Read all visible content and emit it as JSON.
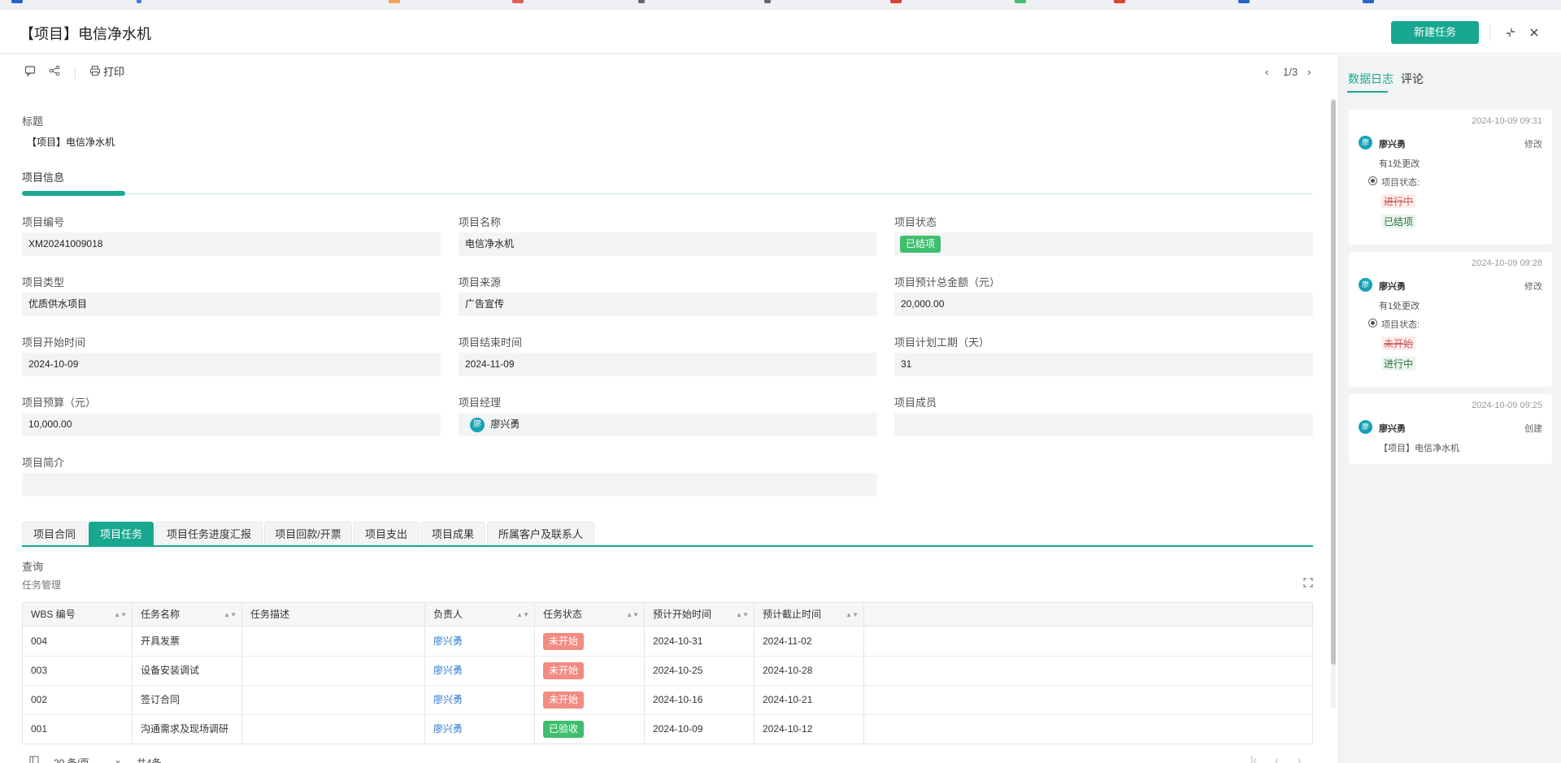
{
  "window": {
    "title": "【项目】电信净水机",
    "new_task_label": "新建任务"
  },
  "toolbar": {
    "print_label": "打印",
    "pager": "1/3"
  },
  "detail": {
    "title_label": "标题",
    "title_value": "【项目】电信净水机",
    "section_label": "项目信息",
    "fields": {
      "code_label": "项目编号",
      "code_value": "XM20241009018",
      "name_label": "项目名称",
      "name_value": "电信净水机",
      "status_label": "项目状态",
      "status_value": "已结项",
      "type_label": "项目类型",
      "type_value": "优质供水项目",
      "source_label": "项目来源",
      "source_value": "广告宣传",
      "amount_label": "项目预计总金额（元）",
      "amount_value": "20,000.00",
      "start_label": "项目开始时间",
      "start_value": "2024-10-09",
      "end_label": "项目结束时间",
      "end_value": "2024-11-09",
      "period_label": "项目计划工期（天）",
      "period_value": "31",
      "budget_label": "项目预算（元）",
      "budget_value": "10,000.00",
      "manager_label": "项目经理",
      "manager_value": "廖兴勇",
      "manager_avatar": "廖",
      "members_label": "项目成员",
      "members_value": "",
      "intro_label": "项目简介",
      "intro_value": ""
    }
  },
  "tabs": [
    {
      "label": "项目合同"
    },
    {
      "label": "项目任务"
    },
    {
      "label": "项目任务进度汇报"
    },
    {
      "label": "项目回款/开票"
    },
    {
      "label": "项目支出"
    },
    {
      "label": "项目成果"
    },
    {
      "label": "所属客户及联系人"
    }
  ],
  "task_panel": {
    "query_label": "查询",
    "grid_title": "任务管理",
    "columns": [
      "WBS 编号",
      "任务名称",
      "任务描述",
      "负责人",
      "任务状态",
      "预计开始时间",
      "预计截止时间"
    ],
    "rows": [
      {
        "wbs": "004",
        "name": "开具发票",
        "desc": "",
        "owner": "廖兴勇",
        "status": "未开始",
        "start": "2024-10-31",
        "end": "2024-11-02"
      },
      {
        "wbs": "003",
        "name": "设备安装调试",
        "desc": "",
        "owner": "廖兴勇",
        "status": "未开始",
        "start": "2024-10-25",
        "end": "2024-10-28"
      },
      {
        "wbs": "002",
        "name": "签订合同",
        "desc": "",
        "owner": "廖兴勇",
        "status": "未开始",
        "start": "2024-10-16",
        "end": "2024-10-21"
      },
      {
        "wbs": "001",
        "name": "沟通需求及现场调研",
        "desc": "",
        "owner": "廖兴勇",
        "status": "已验收",
        "start": "2024-10-09",
        "end": "2024-10-12"
      }
    ],
    "page_size": "20 条/页",
    "total": "共4条"
  },
  "side": {
    "tab_log": "数据日志",
    "tab_comment": "评论",
    "logs": [
      {
        "time": "2024-10-09 09:31",
        "avatar": "廖",
        "user": "廖兴勇",
        "action": "修改",
        "summary": "有1处更改",
        "field": "项目状态:",
        "old": "进行中",
        "new": "已结项"
      },
      {
        "time": "2024-10-09 09:28",
        "avatar": "廖",
        "user": "廖兴勇",
        "action": "修改",
        "summary": "有1处更改",
        "field": "项目状态:",
        "old": "未开始",
        "new": "进行中"
      },
      {
        "time": "2024-10-09 09:25",
        "avatar": "廖",
        "user": "廖兴勇",
        "action": "创建",
        "summary": "【项目】电信净水机"
      }
    ]
  },
  "colors": {
    "accent": "#17a88f",
    "status_done": "#3fbf6e",
    "status_pending": "#f28b82",
    "link": "#2d7bd0"
  }
}
